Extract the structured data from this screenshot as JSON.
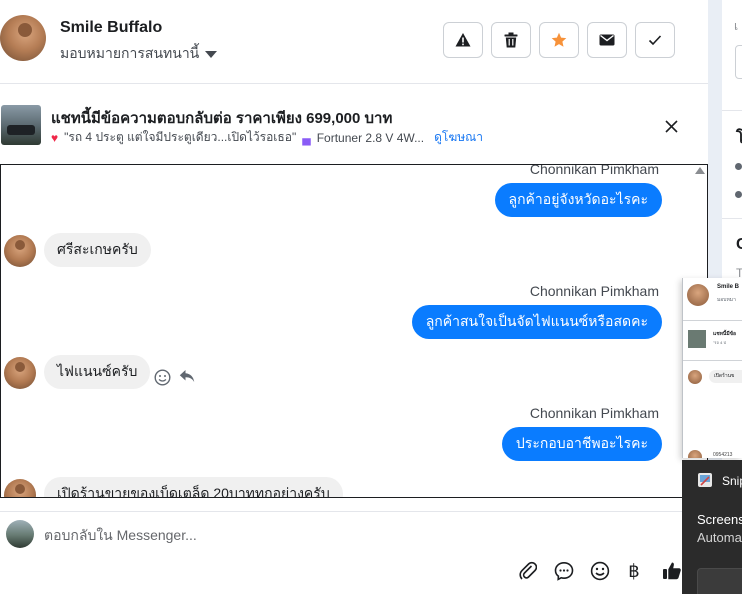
{
  "header": {
    "contact_name": "Smile Buffalo",
    "assign_label": "มอบหมายการสนทนานี้",
    "actions": [
      {
        "name": "mark-spam",
        "icon": "warning-icon"
      },
      {
        "name": "delete",
        "icon": "trash-icon"
      },
      {
        "name": "star",
        "icon": "star-icon",
        "color": "#f7923a"
      },
      {
        "name": "mark-unread",
        "icon": "envelope-icon"
      },
      {
        "name": "mark-done",
        "icon": "check-icon"
      }
    ]
  },
  "ad": {
    "title": "แชทนี้มีข้อความตอบกลับต่อ ราคาเพียง 699,000 บาท",
    "quote": "\"รถ 4 ประตู แต่ใจมีประตูเดียว...เปิดไว้รอเธอ\"",
    "model": "Fortuner 2.8 V 4W...",
    "link": "ดูโฆษณา"
  },
  "messages": {
    "m1": {
      "sender": "Chonnikan Pimkham",
      "text": "ลูกค้าอยู่จังหวัดอะไรคะ"
    },
    "m2": {
      "text": "ศรีสะเกษครับ"
    },
    "m3": {
      "sender": "Chonnikan Pimkham",
      "text": "ลูกค้าสนใจเป็นจัดไฟแนนซ์หรือสดคะ"
    },
    "m4": {
      "text": "ไฟแนนซ์ครับ"
    },
    "m5": {
      "sender": "Chonnikan Pimkham",
      "text": "ประกอบอาชีพอะไรคะ"
    },
    "m6": {
      "text": "เปิดร้านขายของเบ็ดเตล็ด 20บาททุกอย่างครับ"
    }
  },
  "composer": {
    "placeholder": "ตอบกลับใน Messenger..."
  },
  "right_panel": {
    "partial_t1": "เ",
    "partial_t2": "โ",
    "partial_t3": "C",
    "partial_t4": "T"
  },
  "overlay_thumb": {
    "name": "Smile B",
    "sub": "มอบหมา",
    "ad_title": "แชทนี้มีข้อ",
    "ad_sub": "\"รถ 4 ป",
    "bubble": "เปิดร้านข",
    "small": "0954213"
  },
  "toast": {
    "app": "Snip",
    "line1": "Screens",
    "line2": "Automa"
  },
  "colors": {
    "outgoing_bubble": "#0a7cff",
    "incoming_bubble": "#f0f0f0",
    "link": "#1877f2",
    "star": "#f7923a"
  }
}
